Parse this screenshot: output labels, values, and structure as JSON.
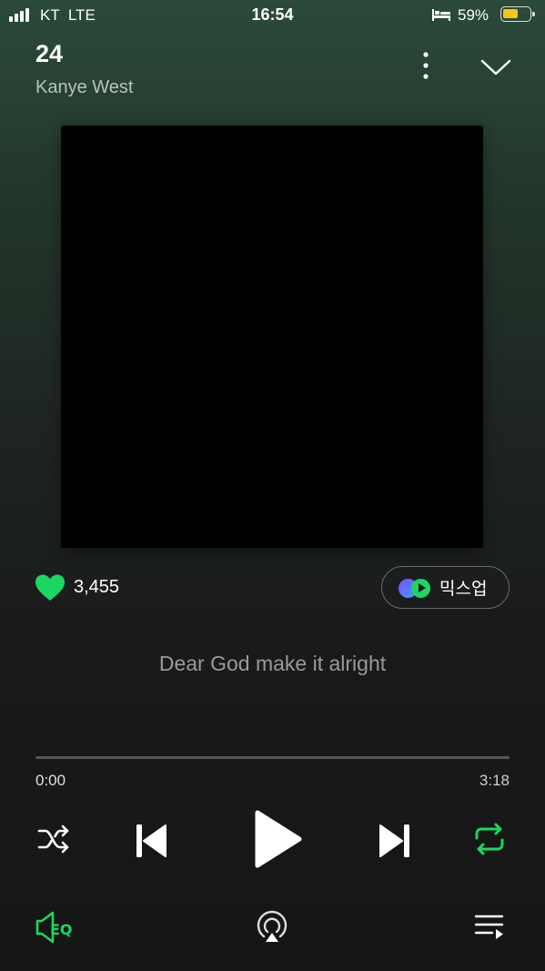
{
  "status_bar": {
    "carrier": "KT  LTE",
    "time": "16:54",
    "battery_percent": "59%",
    "battery_level": 0.59,
    "icons": [
      "signal-icon",
      "bed-icon",
      "battery-icon"
    ]
  },
  "track": {
    "title": "24",
    "artist": "Kanye West"
  },
  "likes": {
    "count": "3,455",
    "color": "#1bd760"
  },
  "mixup": {
    "label": "믹스업"
  },
  "lyrics": {
    "current_line": "Dear God make it alright"
  },
  "progress": {
    "elapsed": "0:00",
    "duration": "3:18",
    "fraction": 0.0
  },
  "controls": {
    "icons": [
      "shuffle-icon",
      "previous-icon",
      "play-icon",
      "next-icon",
      "repeat-icon"
    ],
    "repeat_color": "#1bd760"
  },
  "bottom_bar": {
    "icons": [
      "eq-icon",
      "airplay-icon",
      "queue-icon"
    ],
    "eq_color": "#1bd760"
  },
  "colors": {
    "accent": "#1bd760",
    "background_top": "#2b4a3b",
    "background_bottom": "#161616"
  }
}
